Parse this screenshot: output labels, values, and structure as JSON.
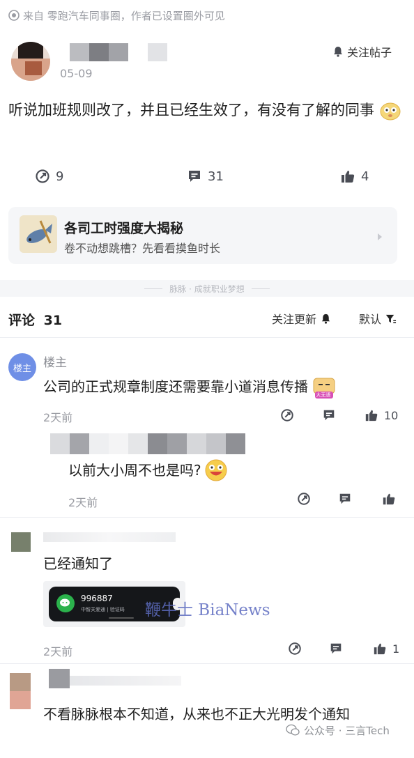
{
  "source_bar": {
    "text": "来自 零跑汽车同事圈，作者已设置圈外可见"
  },
  "post": {
    "date": "05-09",
    "follow_label": "关注帖子",
    "content": "听说加班规则改了，并且已经生效了，有没有了解的同事",
    "shares": "9",
    "comments": "31",
    "likes": "4"
  },
  "promo": {
    "title": "各司工时强度大揭秘",
    "subtitle": "卷不动想跳槽？先看看摸鱼时长"
  },
  "slogan": "脉脉 · 成就职业梦想",
  "comments_header": {
    "title": "评论",
    "count": "31",
    "follow_updates": "关注更新",
    "sort": "默认"
  },
  "comments": [
    {
      "avatar_text": "楼主",
      "name": "楼主",
      "text": "公司的正式规章制度还需要靠小道消息传播",
      "sticker_text": "大无语",
      "time": "2天前",
      "likes": "10",
      "reply": {
        "text": "以前大小周不也是吗?",
        "time": "2天前"
      }
    },
    {
      "text": "已经通知了",
      "screenshot": {
        "code": "996887",
        "sub": "中智关爱通 | 验证码"
      },
      "time": "2天前",
      "likes": "1"
    },
    {
      "text": "不看脉脉根本不知道，从来也不正大光明发个通知"
    }
  ],
  "watermarks": {
    "bianews": "鞭牛士 BiaNews",
    "wechat": "公众号 · 三言Tech"
  },
  "colors": {
    "accent": "#3a64f0",
    "muted": "#9a9ca3",
    "icon": "#4a4d55"
  }
}
